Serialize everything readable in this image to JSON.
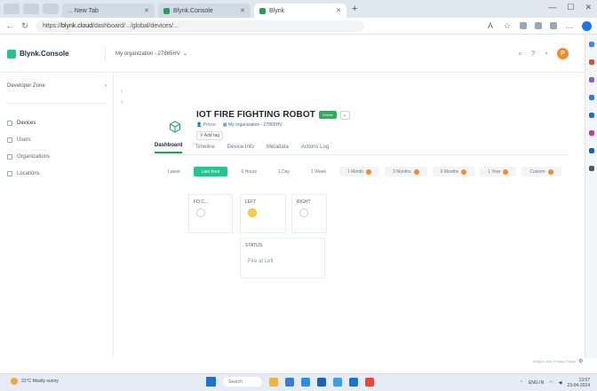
{
  "browser": {
    "tabs": [
      {
        "label": "... New Tab"
      },
      {
        "label": "Blynk.Console"
      },
      {
        "label": "Blynk"
      }
    ],
    "url_prefix": "https://",
    "url_host": "blynk.cloud",
    "url_path": "/dashboard/.../global/devices/..."
  },
  "header": {
    "brand": "Blynk.Console",
    "org_selector": "My organization - 27865HV",
    "avatar_initial": "P"
  },
  "sidebar": {
    "workspace": "Developer Zone",
    "items": [
      {
        "label": "Devices",
        "active": true
      },
      {
        "label": "Users"
      },
      {
        "label": "Organizations"
      },
      {
        "label": "Locations"
      }
    ]
  },
  "device": {
    "title": "IOT FIRE FIGHTING ROBOT",
    "status_badge": "Online",
    "owner": "Prince",
    "organization": "My organization - 27865HV",
    "tag": "Add tag"
  },
  "tabs": [
    {
      "label": "Dashboard",
      "active": true
    },
    {
      "label": "Timeline"
    },
    {
      "label": "Device Info"
    },
    {
      "label": "Metadata"
    },
    {
      "label": "Actions Log"
    }
  ],
  "time_ranges": [
    {
      "label": "Latest"
    },
    {
      "label": "Last hour",
      "active": true
    },
    {
      "label": "6 Hours"
    },
    {
      "label": "1 Day"
    },
    {
      "label": "1 Week"
    },
    {
      "label": "1 Month",
      "pro": true
    },
    {
      "label": "3 Months",
      "pro": true
    },
    {
      "label": "6 Months",
      "pro": true
    },
    {
      "label": "1 Year",
      "pro": true
    },
    {
      "label": "Custom",
      "pro": true
    }
  ],
  "widgets": [
    {
      "label": "FO C...",
      "led_on": false
    },
    {
      "label": "LEFT",
      "led_on": true
    },
    {
      "label": "RIGHT",
      "led_on": false
    }
  ],
  "status_widget": {
    "label": "STATUS",
    "value": "Fire at Left"
  },
  "footer": {
    "text": "Region: fra1  Privacy Policy"
  },
  "taskbar": {
    "weather_temp": "31°C",
    "weather_desc": "Mostly sunny",
    "search_placeholder": "Search",
    "language": "ENG IN",
    "time": "13:57",
    "date": "23-04-2024"
  },
  "colors": {
    "brand_green": "#23c48e",
    "online_green": "#27b15f",
    "led_yellow": "#f4d04a",
    "pro_orange": "#f28c28"
  }
}
